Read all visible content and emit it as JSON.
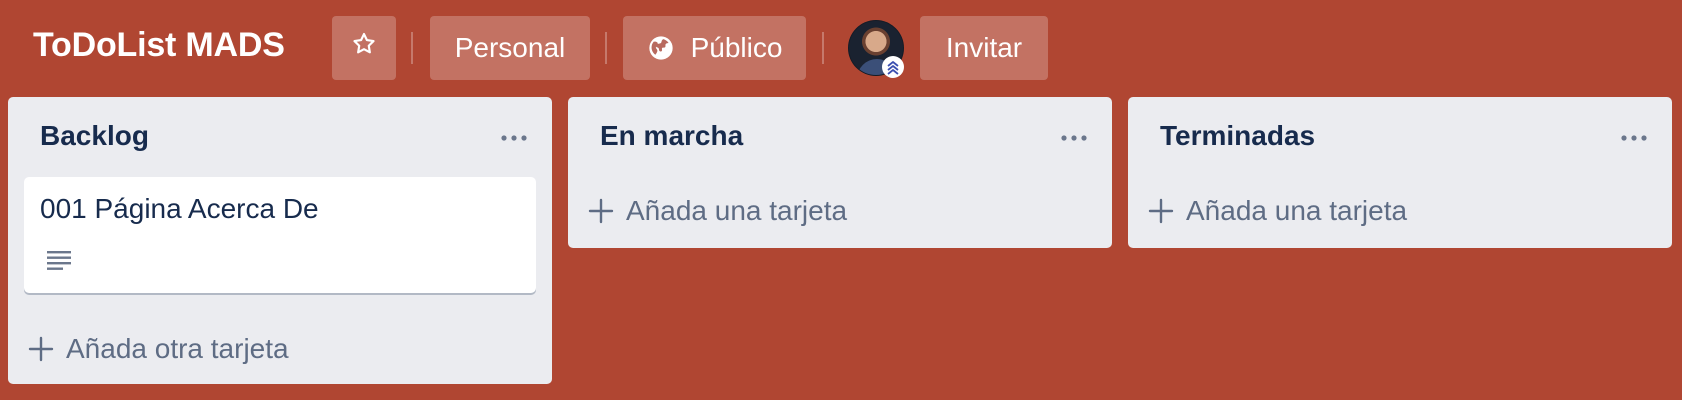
{
  "header": {
    "board_title": "ToDoList MADS",
    "star_icon": "star-outline-icon",
    "team_label": "Personal",
    "visibility": {
      "icon": "globe-icon",
      "label": "Público"
    },
    "member": {
      "avatar": "user-avatar",
      "badge_icon": "chevron-up-admin-icon"
    },
    "invite_label": "Invitar"
  },
  "colors": {
    "board_background": "#b04632",
    "list_background": "#ebecf0",
    "card_background": "#ffffff",
    "text_primary": "#172b4d",
    "text_secondary": "#5e6c84"
  },
  "lists": [
    {
      "title": "Backlog",
      "menu_icon": "ellipsis-icon",
      "cards": [
        {
          "title": "001 Página Acerca De",
          "badge_icon": "description-icon"
        }
      ],
      "add_label": "Añada otra tarjeta"
    },
    {
      "title": "En marcha",
      "menu_icon": "ellipsis-icon",
      "cards": [],
      "add_label": "Añada una tarjeta"
    },
    {
      "title": "Terminadas",
      "menu_icon": "ellipsis-icon",
      "cards": [],
      "add_label": "Añada una tarjeta"
    }
  ]
}
